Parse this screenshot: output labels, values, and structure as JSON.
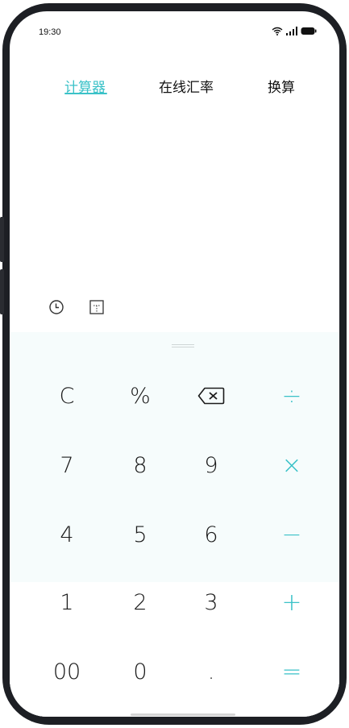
{
  "status_bar": {
    "time": "19:30"
  },
  "tabs": [
    {
      "label": "计算器",
      "active": true
    },
    {
      "label": "在线汇率",
      "active": false
    },
    {
      "label": "换算",
      "active": false
    }
  ],
  "tools": [
    {
      "icon": "history-icon"
    },
    {
      "icon": "scientific-mode-icon"
    }
  ],
  "keypad": {
    "rows": [
      [
        {
          "label": "C"
        },
        {
          "label": "%"
        },
        {
          "label": "",
          "icon": "backspace-icon"
        },
        {
          "label": "÷"
        }
      ],
      [
        {
          "label": "7"
        },
        {
          "label": "8"
        },
        {
          "label": "9"
        },
        {
          "label": "×"
        }
      ],
      [
        {
          "label": "4"
        },
        {
          "label": "5"
        },
        {
          "label": "6"
        },
        {
          "label": "−"
        }
      ],
      [
        {
          "label": "1"
        },
        {
          "label": "2"
        },
        {
          "label": "3"
        },
        {
          "label": "+"
        }
      ],
      [
        {
          "label": "00"
        },
        {
          "label": "0"
        },
        {
          "label": "."
        },
        {
          "label": "="
        }
      ]
    ]
  },
  "colors": {
    "accent": "#3bc2c8",
    "keypad_bg": "#f6fcfc",
    "text": "#1b1b1b",
    "frame": "#1d1f24"
  }
}
